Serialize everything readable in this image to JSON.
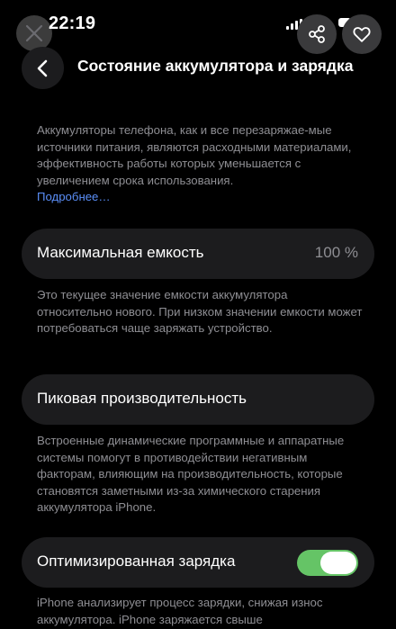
{
  "status_bar": {
    "time": "22:19"
  },
  "header": {
    "title": "Состояние аккумулятора и зарядка"
  },
  "intro": {
    "text": "Аккумуляторы телефона, как и все перезаряжае-мые источники питания, являются расходными материалами, эффективность работы которых уменьшается с увеличением срока использования.",
    "link": "Подробнее…"
  },
  "max_capacity": {
    "label": "Максимальная емкость",
    "value": "100 %",
    "description": "Это текущее значение емкости аккумулятора относительно нового. При низком значении емкости может потребоваться чаще заряжать устройство."
  },
  "peak_performance": {
    "label": "Пиковая производительность",
    "description": "Встроенные динамические программные и аппаратные системы помогут в противодействии негативным факторам, влияющим на производительность, которые становятся заметными из-за химического старения аккумулятора iPhone."
  },
  "optimized_charging": {
    "label": "Оптимизированная зарядка",
    "enabled": true,
    "description": "iPhone анализирует процесс зарядки, снижая износ аккумулятора. iPhone заряжается свыше"
  },
  "colors": {
    "accent_link": "#5b8ff9",
    "toggle_on": "#65c466",
    "card_bg": "#1c1c1e"
  },
  "icons": [
    "close-icon",
    "cellular-signal-icon",
    "battery-icon",
    "share-icon",
    "heart-icon",
    "chevron-left-icon"
  ]
}
